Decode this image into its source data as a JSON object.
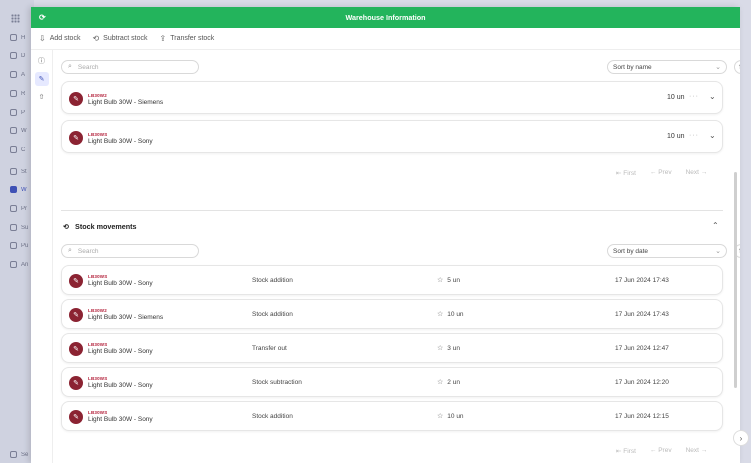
{
  "app_sidebar": {
    "items": [
      {
        "label": "H",
        "icon": "clock-icon"
      },
      {
        "label": "D",
        "icon": "dashboard-icon"
      },
      {
        "label": "A",
        "icon": "analytics-icon"
      },
      {
        "label": "R",
        "icon": "box-icon"
      },
      {
        "label": "P",
        "icon": "grid-icon"
      },
      {
        "label": "W",
        "icon": "list-icon"
      },
      {
        "label": "C",
        "icon": "calendar-icon"
      },
      {
        "label": "St",
        "icon": "chart-icon"
      },
      {
        "label": "W",
        "icon": "warehouse-icon",
        "active": true
      },
      {
        "label": "Pr",
        "icon": "tool-icon"
      },
      {
        "label": "Su",
        "icon": "truck-icon"
      },
      {
        "label": "Pu",
        "icon": "cart-icon"
      },
      {
        "label": "An",
        "icon": "bar-chart-icon"
      }
    ],
    "footer_label": "Se"
  },
  "header": {
    "title": "Warehouse Information"
  },
  "toolbar": {
    "add_stock": "Add stock",
    "subtract_stock": "Subtract stock",
    "transfer_stock": "Transfer stock"
  },
  "stock": {
    "search_placeholder": "Search",
    "sort_label": "Sort by name",
    "items": [
      {
        "code": "LB30W2",
        "name": "Light Bulb 30W - Siemens",
        "qty": "10 un"
      },
      {
        "code": "LB30WS",
        "name": "Light Bulb 30W - Sony",
        "qty": "10 un"
      }
    ],
    "pager": {
      "first": "First",
      "prev": "Prev",
      "next": "Next"
    }
  },
  "movements": {
    "title": "Stock movements",
    "search_placeholder": "Search",
    "sort_label": "Sort by date",
    "rows": [
      {
        "code": "LB30WS",
        "name": "Light Bulb 30W - Sony",
        "type": "Stock addition",
        "qty": "5 un",
        "date": "17 Jun 2024 17:43"
      },
      {
        "code": "LB30W2",
        "name": "Light Bulb 30W - Siemens",
        "type": "Stock addition",
        "qty": "10 un",
        "date": "17 Jun 2024 17:43"
      },
      {
        "code": "LB30WS",
        "name": "Light Bulb 30W - Sony",
        "type": "Transfer out",
        "qty": "3 un",
        "date": "17 Jun 2024 12:47"
      },
      {
        "code": "LB30WS",
        "name": "Light Bulb 30W - Sony",
        "type": "Stock subtraction",
        "qty": "2 un",
        "date": "17 Jun 2024 12:20"
      },
      {
        "code": "LB30WS",
        "name": "Light Bulb 30W - Sony",
        "type": "Stock addition",
        "qty": "10 un",
        "date": "17 Jun 2024 12:15"
      }
    ],
    "pager": {
      "first": "First",
      "prev": "Prev",
      "next": "Next"
    }
  },
  "colors": {
    "header": "#23b45c",
    "product_icon": "#8b2332",
    "code_text": "#b3203a"
  }
}
